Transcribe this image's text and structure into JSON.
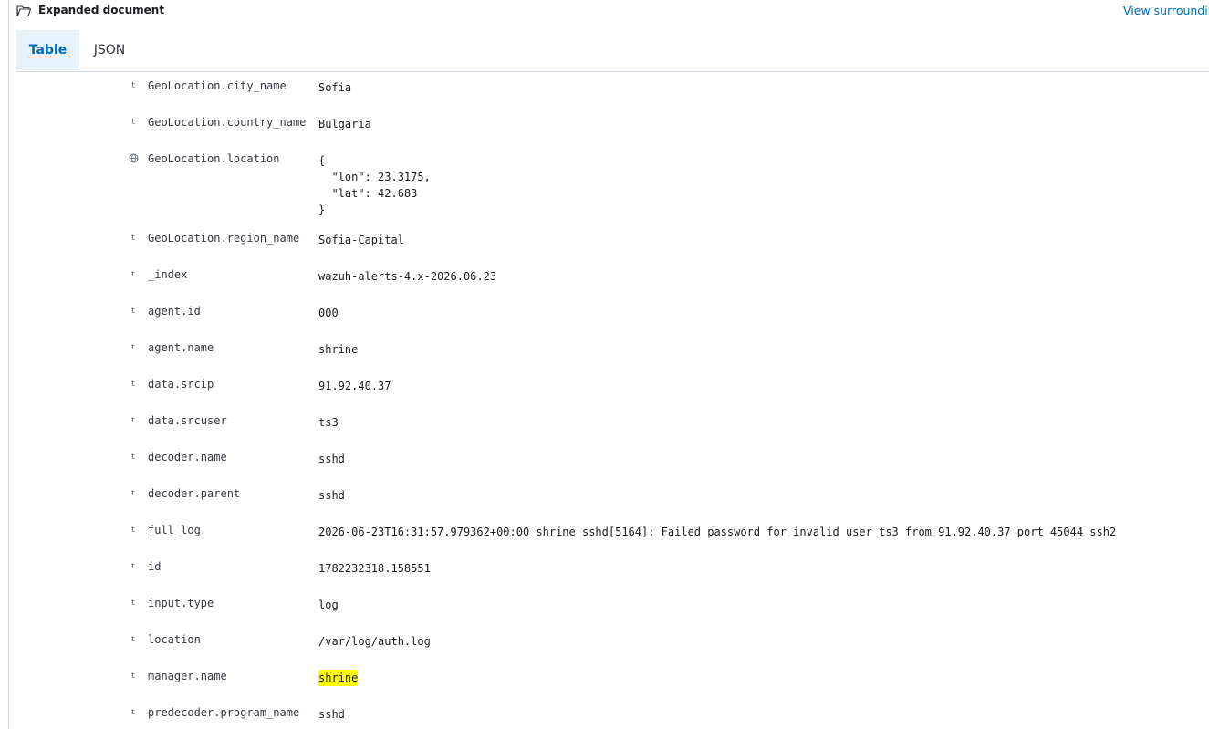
{
  "header": {
    "title": "Expanded document",
    "view_link": "View surroundir"
  },
  "tabs": [
    {
      "label": "Table",
      "selected": true
    },
    {
      "label": "JSON",
      "selected": false
    }
  ],
  "rows": [
    {
      "icon": "string-type-icon",
      "glyph": "t",
      "name": "GeoLocation.city_name",
      "value": "Sofia"
    },
    {
      "icon": "string-type-icon",
      "glyph": "t",
      "name": "GeoLocation.country_name",
      "value": "Bulgaria"
    },
    {
      "icon": "globe-icon",
      "glyph": "",
      "name": "GeoLocation.location",
      "value": "{\n  \"lon\": 23.3175,\n  \"lat\": 42.683\n}"
    },
    {
      "icon": "string-type-icon",
      "glyph": "t",
      "name": "GeoLocation.region_name",
      "value": "Sofia-Capital"
    },
    {
      "icon": "string-type-icon",
      "glyph": "t",
      "name": "_index",
      "value": "wazuh-alerts-4.x-2026.06.23"
    },
    {
      "icon": "string-type-icon",
      "glyph": "t",
      "name": "agent.id",
      "value": "000"
    },
    {
      "icon": "string-type-icon",
      "glyph": "t",
      "name": "agent.name",
      "value": "shrine"
    },
    {
      "icon": "string-type-icon",
      "glyph": "t",
      "name": "data.srcip",
      "value": "91.92.40.37"
    },
    {
      "icon": "string-type-icon",
      "glyph": "t",
      "name": "data.srcuser",
      "value": "ts3"
    },
    {
      "icon": "string-type-icon",
      "glyph": "t",
      "name": "decoder.name",
      "value": "sshd"
    },
    {
      "icon": "string-type-icon",
      "glyph": "t",
      "name": "decoder.parent",
      "value": "sshd"
    },
    {
      "icon": "string-type-icon",
      "glyph": "t",
      "name": "full_log",
      "value": "2026-06-23T16:31:57.979362+00:00 shrine sshd[5164]: Failed password for invalid user ts3 from 91.92.40.37 port 45044 ssh2"
    },
    {
      "icon": "string-type-icon",
      "glyph": "t",
      "name": "id",
      "value": "1782232318.158551"
    },
    {
      "icon": "string-type-icon",
      "glyph": "t",
      "name": "input.type",
      "value": "log"
    },
    {
      "icon": "string-type-icon",
      "glyph": "t",
      "name": "location",
      "value": "/var/log/auth.log"
    },
    {
      "icon": "string-type-icon",
      "glyph": "t",
      "name": "manager.name",
      "value": "shrine",
      "highlighted": true
    },
    {
      "icon": "string-type-icon",
      "glyph": "t",
      "name": "predecoder.program_name",
      "value": "sshd"
    }
  ],
  "colors": {
    "link": "#006bb8",
    "selected_tab_bg": "#e6f1fa",
    "highlight": "#ffff00"
  }
}
